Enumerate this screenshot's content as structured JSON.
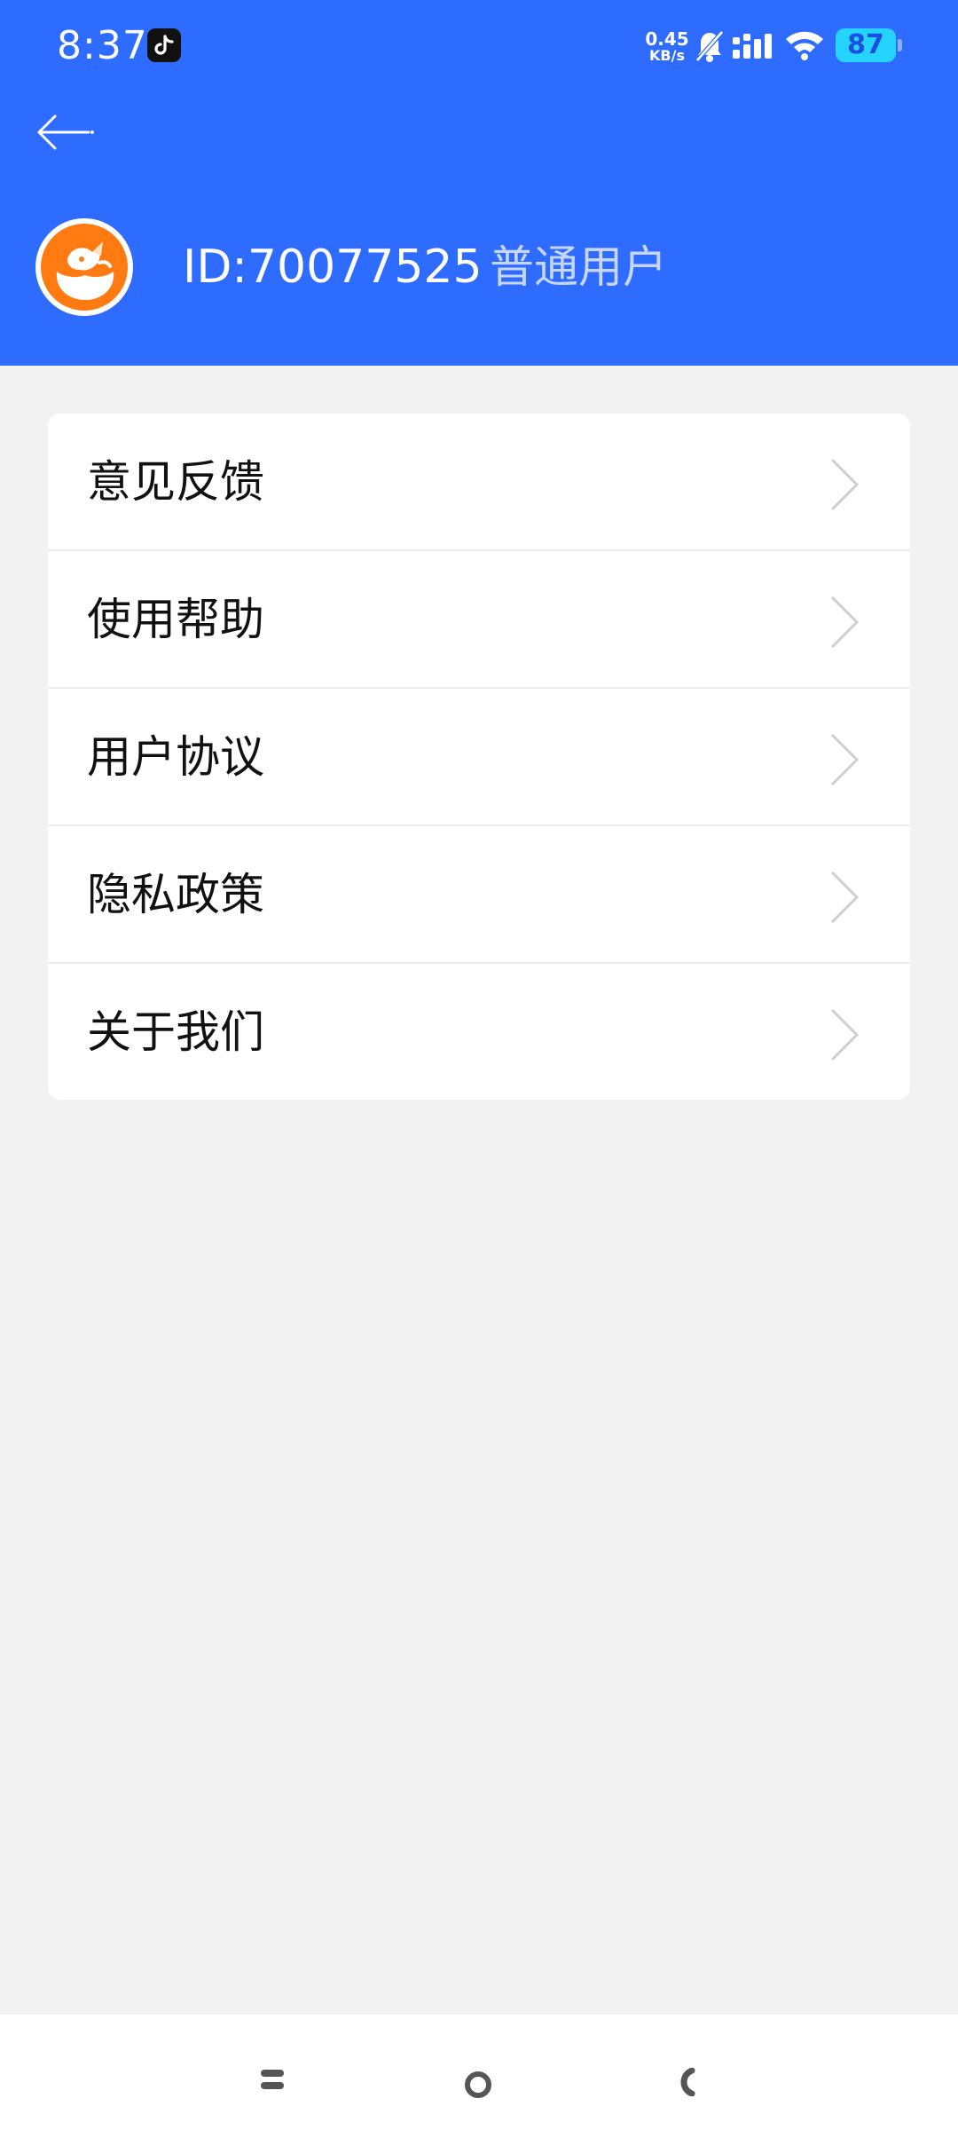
{
  "status_bar": {
    "time": "8:37",
    "app_icon": "tiktok-icon",
    "net_speed_value": "0.45",
    "net_speed_unit": "KB/s",
    "mute_icon": "bell-off-icon",
    "signal_icon": "signal-icon",
    "wifi_icon": "wifi-icon",
    "battery_level": "87",
    "battery_color": "#24d4ff"
  },
  "header": {
    "back_icon": "arrow-left-icon",
    "background_color": "#2e6bff"
  },
  "profile": {
    "avatar_icon": "fox-avatar-icon",
    "avatar_color": "#ff7b12",
    "user_id": "ID:70077525",
    "user_level": "普通用户"
  },
  "menu": {
    "chevron_icon": "chevron-right-icon",
    "items": [
      {
        "label": "意见反馈"
      },
      {
        "label": "使用帮助"
      },
      {
        "label": "用户协议"
      },
      {
        "label": "隐私政策"
      },
      {
        "label": "关于我们"
      }
    ]
  },
  "nav_bar": {
    "menu_icon": "recent-apps-icon",
    "home_icon": "home-circle-icon",
    "back_icon": "back-chevron-icon"
  }
}
